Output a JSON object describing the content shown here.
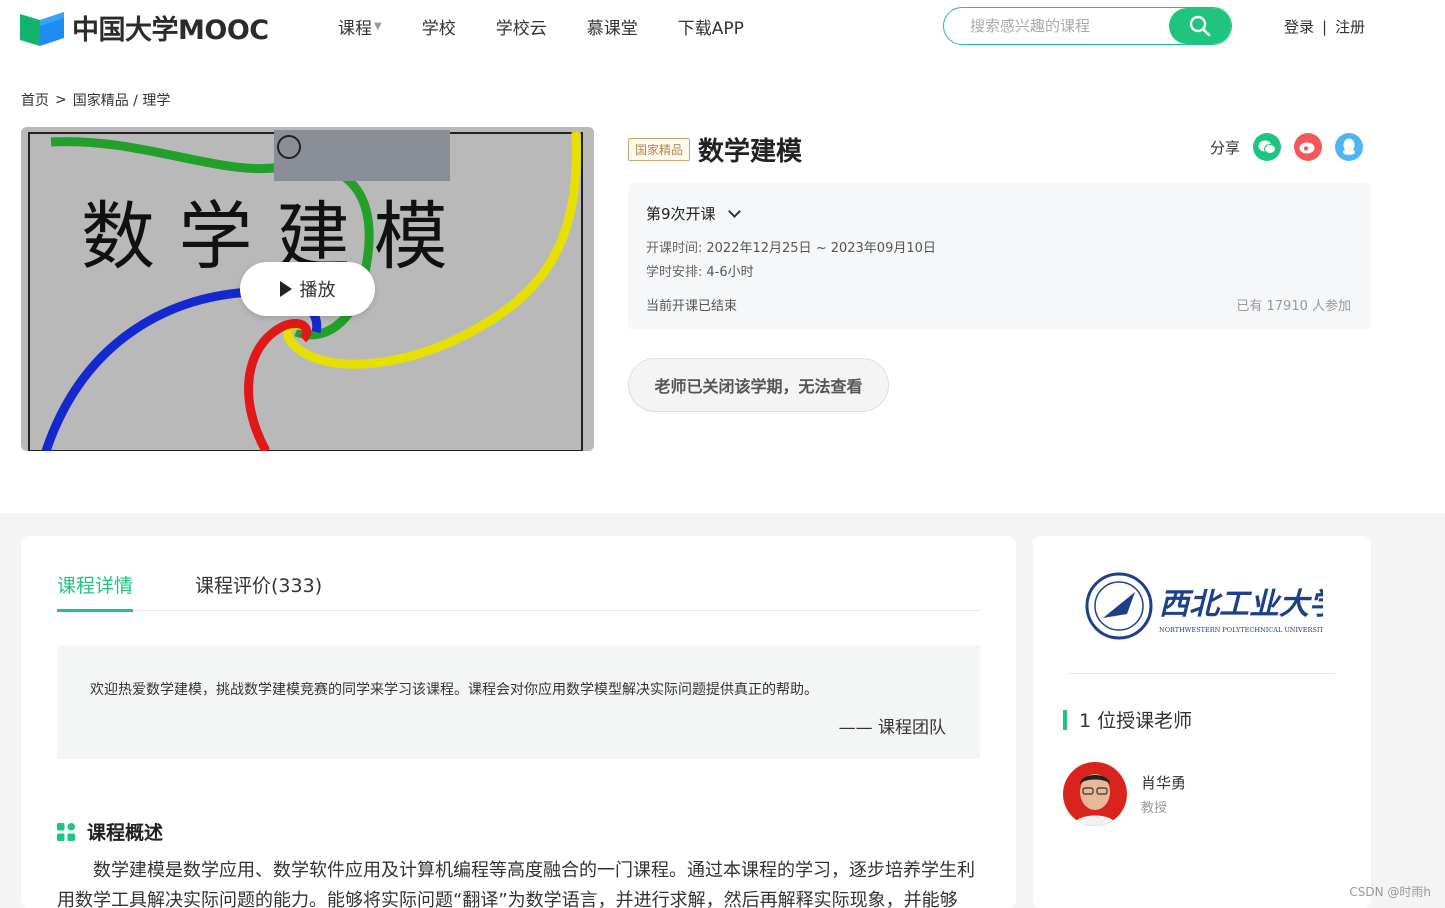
{
  "header": {
    "logo_text": "中国大学MOOC",
    "nav": [
      {
        "label": "课程",
        "has_dropdown": true
      },
      {
        "label": "学校"
      },
      {
        "label": "学校云"
      },
      {
        "label": "慕课堂"
      },
      {
        "label": "下载APP"
      }
    ],
    "search_placeholder": "搜索感兴趣的课程",
    "login": "登录",
    "register": "注册",
    "accent": "#1ec47f"
  },
  "breadcrumb": {
    "home": "首页",
    "separator": ">",
    "path": "国家精品 / 理学"
  },
  "video": {
    "cover_title": "数 学 建 模",
    "play_label": "播放"
  },
  "course": {
    "tag": "国家精品",
    "title": "数学建模",
    "share_label": "分享",
    "share_icons": [
      "wechat-icon",
      "weibo-icon",
      "qq-icon"
    ],
    "term": {
      "label": "第9次开课",
      "time_label": "开课时间:",
      "time_value": "2022年12月25日 ~ 2023年09月10日",
      "hours_label": "学时安排:",
      "hours_value": "4-6小时",
      "status": "当前开课已结束",
      "participants": "已有 17910 人参加"
    },
    "closed_notice": "老师已关闭该学期，无法查看"
  },
  "tabs": [
    {
      "label": "课程详情",
      "active": true
    },
    {
      "label": "课程评价(333)",
      "active": false
    }
  ],
  "intro": {
    "text": "欢迎热爱数学建模，挑战数学建模竞赛的同学来学习该课程。课程会对你应用数学模型解决实际问题提供真正的帮助。",
    "signature": "—— 课程团队"
  },
  "overview": {
    "title": "课程概述",
    "body": "数学建模是数学应用、数学软件应用及计算机编程等高度融合的一门课程。通过本课程的学习，逐步培养学生利用数学工具解决实际问题的能力。能够将实际问题“翻译”为数学语言，并进行求解，然后再解释实际现象，并能够"
  },
  "sidebar": {
    "university_name": "西北工业大学",
    "university_en": "NORTHWESTERN POLYTECHNICAL UNIVERSITY",
    "teacher_count": "1 位授课老师",
    "teachers": [
      {
        "name": "肖华勇",
        "title": "教授"
      }
    ]
  },
  "watermark": "CSDN @时雨h"
}
